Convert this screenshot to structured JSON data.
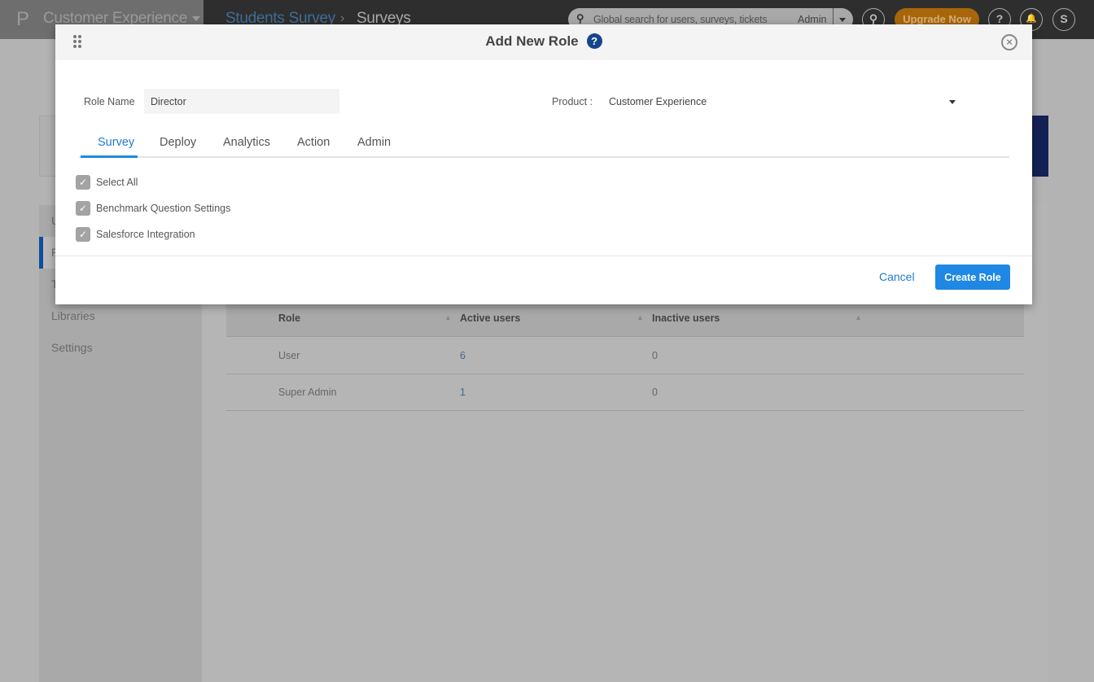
{
  "topbar": {
    "product": "Customer Experience",
    "breadcrumb": [
      "Students Survey",
      "Surveys"
    ],
    "breadcrumb_sep": "›",
    "search_placeholder": "Global search for users, surveys, tickets",
    "search_scope": "Admin",
    "upgrade_label": "Upgrade Now",
    "avatar_initial": "S",
    "help_glyph": "?",
    "bell_glyph": "🔔",
    "search_glyph": "⚲",
    "logo_glyph": "P"
  },
  "sidebar": {
    "items": [
      {
        "label": "U"
      },
      {
        "label": "R",
        "active": true
      },
      {
        "label": "T"
      },
      {
        "label": "Libraries"
      },
      {
        "label": "Settings"
      }
    ]
  },
  "table": {
    "headers": [
      "Role",
      "Active users",
      "Inactive users"
    ],
    "rows": [
      [
        "User",
        "6",
        "0"
      ],
      [
        "Super Admin",
        "1",
        "0"
      ]
    ]
  },
  "modal": {
    "title": "Add New Role",
    "role_name_label": "Role Name",
    "role_name_value": "Director",
    "product_label": "Product :",
    "product_value": "Customer Experience",
    "tabs": [
      "Survey",
      "Deploy",
      "Analytics",
      "Action",
      "Admin"
    ],
    "active_tab": "Survey",
    "checkboxes": [
      {
        "label": "Select All",
        "checked": true
      },
      {
        "label": "Benchmark Question Settings",
        "checked": true
      },
      {
        "label": "Salesforce Integration",
        "checked": true
      }
    ],
    "cancel_label": "Cancel",
    "create_label": "Create Role",
    "close_glyph": "×",
    "check_glyph": "✓",
    "help_glyph": "?"
  },
  "colors": {
    "accent": "#1f88e5",
    "upgrade": "#a8660a",
    "help_badge": "#16458a"
  }
}
